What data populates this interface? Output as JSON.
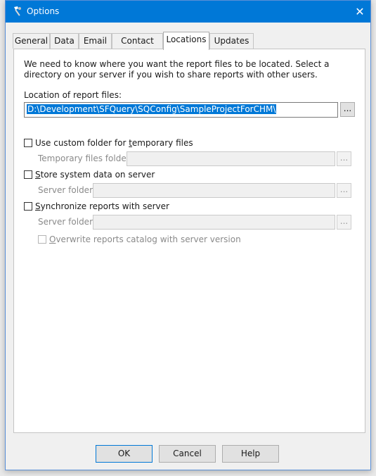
{
  "window": {
    "title": "Options",
    "close_glyph": "✕"
  },
  "tabs": [
    {
      "label": "General"
    },
    {
      "label": "Data"
    },
    {
      "label": "Email"
    },
    {
      "label": "Contact"
    },
    {
      "label": "Locations"
    },
    {
      "label": "Updates"
    }
  ],
  "active_tab": "Locations",
  "locations": {
    "description": "We need to know where you want the report files to be located. Select a directory on your server if you wish to share reports with other users.",
    "report_files_label": "Location of report files:",
    "report_files_value": "D:\\Development\\SFQuery\\SQConfig\\SampleProjectForCHM\\",
    "browse_label": "...",
    "custom_temp": {
      "label_pre": "Use custom folder for ",
      "label_ul": "t",
      "label_post": "emporary files",
      "checked": false,
      "field_label": "Temporary files folder",
      "browse_label": "..."
    },
    "system_data": {
      "label_ul": "S",
      "label_post": "tore system data on server",
      "checked": false,
      "field_label": "Server folder",
      "browse_label": "..."
    },
    "sync_reports": {
      "label_ul": "S",
      "label_post": "ynchronize reports with server",
      "checked": false,
      "field_label": "Server folder",
      "browse_label": "...",
      "overwrite_ul": "O",
      "overwrite_post": "verwrite reports catalog with server version",
      "overwrite_checked": false
    }
  },
  "footer": {
    "ok": "OK",
    "cancel": "Cancel",
    "help": "Help"
  },
  "colors": {
    "accent": "#0078d7",
    "panel": "#ffffff",
    "window": "#f0f0f0"
  },
  "icons": {
    "app": "wrench-hammer-icon",
    "close": "close-icon"
  }
}
